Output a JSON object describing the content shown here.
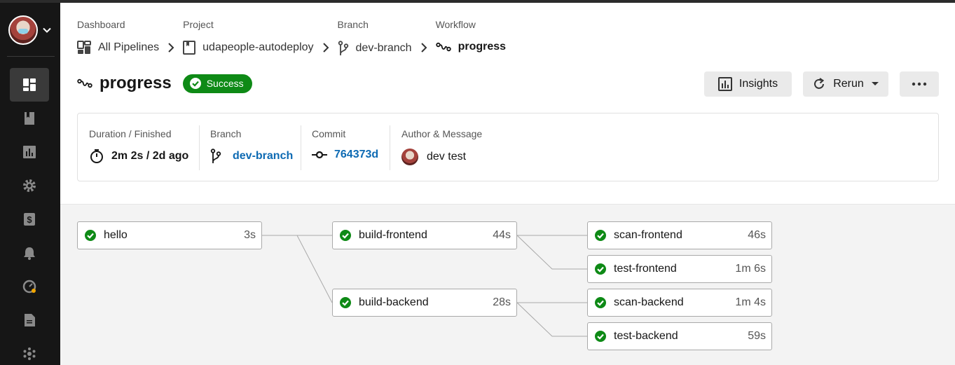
{
  "breadcrumbs": [
    {
      "label": "Dashboard",
      "text": "All Pipelines"
    },
    {
      "label": "Project",
      "text": "udapeople-autodeploy"
    },
    {
      "label": "Branch",
      "text": "dev-branch"
    },
    {
      "label": "Workflow",
      "text": "progress"
    }
  ],
  "workflow": {
    "title": "progress",
    "status": "Success",
    "status_color": "#0e8a16"
  },
  "actions": {
    "insights": "Insights",
    "rerun": "Rerun"
  },
  "info": {
    "duration_label": "Duration / Finished",
    "duration_value": "2m 2s / 2d ago",
    "branch_label": "Branch",
    "branch_value": "dev-branch",
    "commit_label": "Commit",
    "commit_value": "764373d",
    "author_label": "Author & Message",
    "author_value": "dev test"
  },
  "jobs": [
    {
      "name": "hello",
      "duration": "3s"
    },
    {
      "name": "build-frontend",
      "duration": "44s"
    },
    {
      "name": "build-backend",
      "duration": "28s"
    },
    {
      "name": "scan-frontend",
      "duration": "46s"
    },
    {
      "name": "test-frontend",
      "duration": "1m 6s"
    },
    {
      "name": "scan-backend",
      "duration": "1m 4s"
    },
    {
      "name": "test-backend",
      "duration": "59s"
    }
  ],
  "sidebar": {
    "icons": [
      "dashboard-icon",
      "projects-icon",
      "insights-icon",
      "settings-icon",
      "plan-icon",
      "notifications-icon",
      "status-icon",
      "docs-icon",
      "community-icon"
    ]
  },
  "colors": {
    "accent_link": "#0d6ab3",
    "success": "#0e8a16",
    "sidebar_bg": "#161616"
  }
}
